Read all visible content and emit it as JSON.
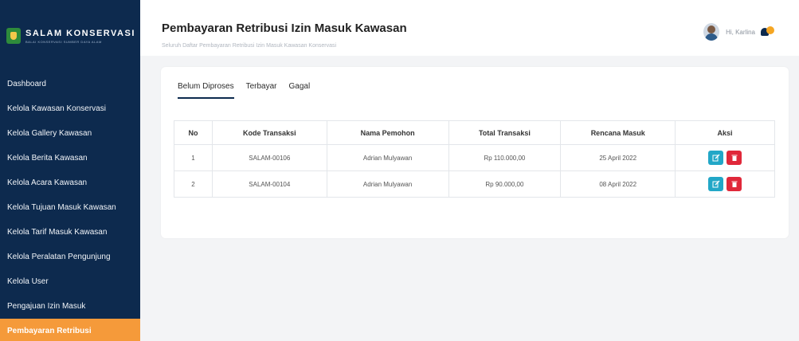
{
  "brand": {
    "title": "SALAM KONSERVASI",
    "subtitle": "BALAI KONSERVASI SUMBER DAYA ALAM"
  },
  "sidebar": {
    "items": [
      {
        "label": "Dashboard"
      },
      {
        "label": "Kelola Kawasan Konservasi"
      },
      {
        "label": "Kelola Gallery Kawasan"
      },
      {
        "label": "Kelola Berita Kawasan"
      },
      {
        "label": "Kelola Acara Kawasan"
      },
      {
        "label": "Kelola Tujuan Masuk Kawasan"
      },
      {
        "label": "Kelola Tarif Masuk Kawasan"
      },
      {
        "label": "Kelola Peralatan Pengunjung"
      },
      {
        "label": "Kelola User"
      },
      {
        "label": "Pengajuan Izin Masuk"
      },
      {
        "label": "Pembayaran Retribusi"
      }
    ]
  },
  "header": {
    "title": "Pembayaran Retribusi Izin Masuk Kawasan",
    "subtitle": "Seluruh Daftar Pembayaran Retribusi Izin Masuk Kawasan Konservasi",
    "user_greeting": "Hi, Karlina"
  },
  "tabs": [
    {
      "label": "Belum Diproses"
    },
    {
      "label": "Terbayar"
    },
    {
      "label": "Gagal"
    }
  ],
  "table": {
    "headers": [
      "No",
      "Kode Transaksi",
      "Nama Pemohon",
      "Total Transaksi",
      "Rencana Masuk",
      "Aksi"
    ],
    "rows": [
      [
        "1",
        "SALAM-00106",
        "Adrian Mulyawan",
        "Rp 110.000,00",
        "25 April 2022"
      ],
      [
        "2",
        "SALAM-00104",
        "Adrian Mulyawan",
        "Rp 90.000,00",
        "08 April 2022"
      ]
    ]
  },
  "colors": {
    "sidebar": "#0d2a4e",
    "active": "#f59a3a",
    "edit": "#22a7c7",
    "delete": "#e0283a"
  },
  "icons": {
    "edit": "edit-icon",
    "delete": "trash-icon",
    "bell": "bell-icon"
  }
}
